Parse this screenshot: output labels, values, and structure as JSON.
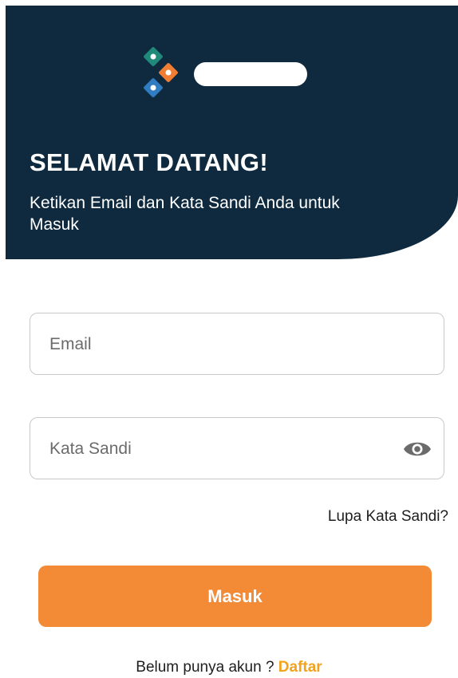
{
  "header": {
    "title": "SELAMAT DATANG!",
    "subtitle": "Ketikan Email dan Kata Sandi Anda untuk Masuk",
    "logo_icon": "diamond-logo-icon"
  },
  "form": {
    "email_placeholder": "Email",
    "password_placeholder": "Kata Sandi",
    "toggle_icon": "eye-icon",
    "forgot_label": "Lupa Kata Sandi?",
    "submit_label": "Masuk"
  },
  "footer": {
    "prompt": "Belum punya akun ? ",
    "register_label": "Daftar"
  },
  "colors": {
    "header_bg": "#0f2a3f",
    "primary": "#f38a36",
    "link": "#f3a21c",
    "logo_green": "#1f8a7a",
    "logo_orange": "#ef7d33",
    "logo_blue": "#2f7cc2"
  }
}
